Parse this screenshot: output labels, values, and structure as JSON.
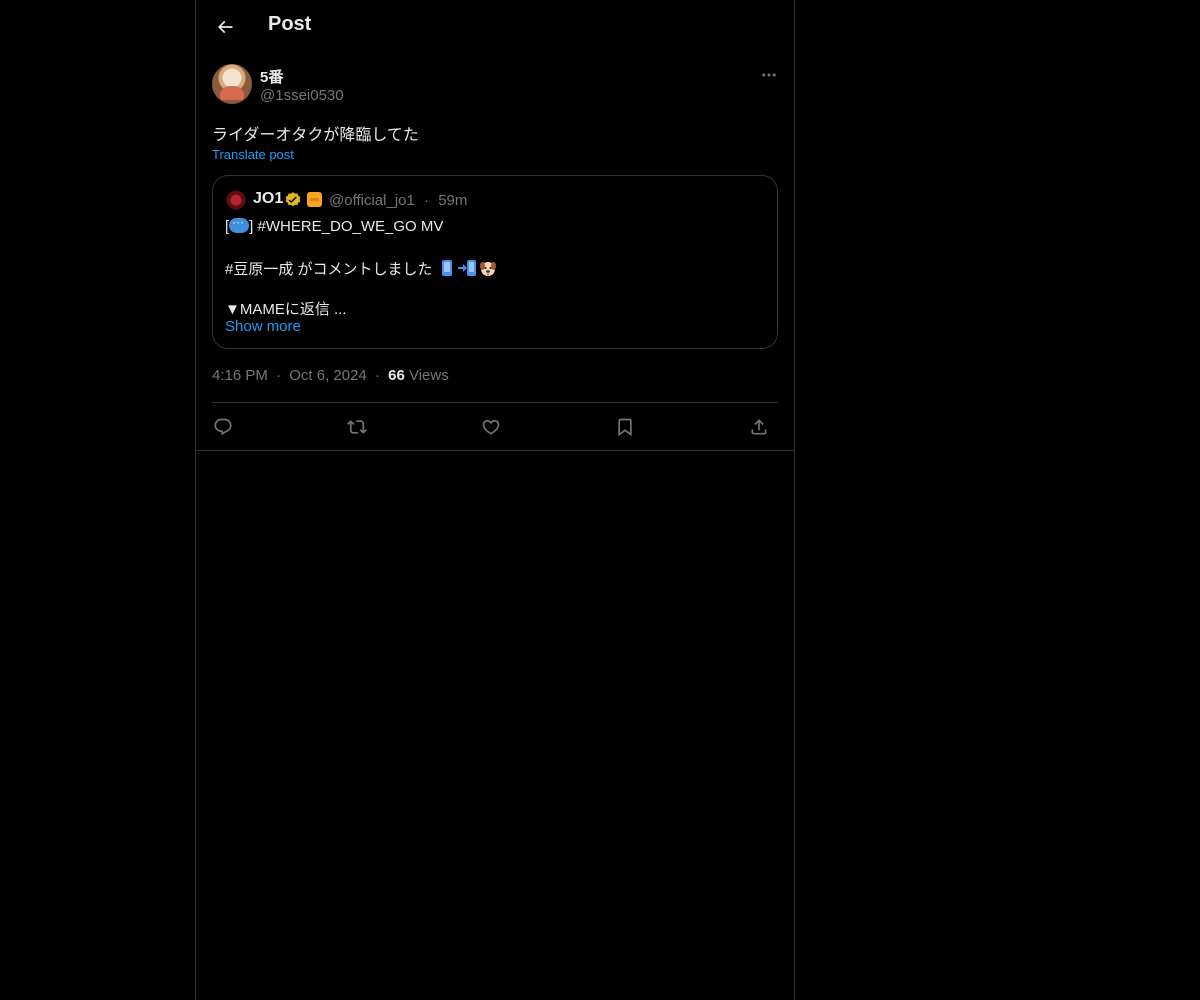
{
  "header": {
    "title": "Post"
  },
  "post": {
    "author": {
      "display_name": "5番",
      "handle": "@1ssei0530"
    },
    "text": "ライダーオタクが降臨してた",
    "translate_label": "Translate post",
    "timestamp": "4:16 PM",
    "date": "Oct 6, 2024",
    "views_count": "66",
    "views_label": "Views",
    "separator": "·"
  },
  "quote": {
    "name": "JO1",
    "handle": "@official_jo1",
    "separator": "·",
    "time": "59m",
    "lines": [
      {
        "before": "[",
        "after": "] #WHERE_DO_WE_GO MV"
      },
      {
        "text": "#豆原一成 がコメントしました"
      },
      {
        "text": "▼MAMEに返信  ..."
      }
    ],
    "show_more": "Show more"
  },
  "icons": {
    "back": "arrow-left-icon",
    "more": "more-horizontal-icon",
    "reply": "reply-icon",
    "repost": "repost-icon",
    "like": "heart-icon",
    "bookmark": "bookmark-icon",
    "share": "share-icon",
    "verified": "verified-badge-icon"
  },
  "colors": {
    "background": "#000000",
    "text": "#e7e9ea",
    "secondary": "#71767b",
    "accent": "#1d9bf0",
    "border": "#2f3336",
    "verified_gold": "#e2b719"
  }
}
